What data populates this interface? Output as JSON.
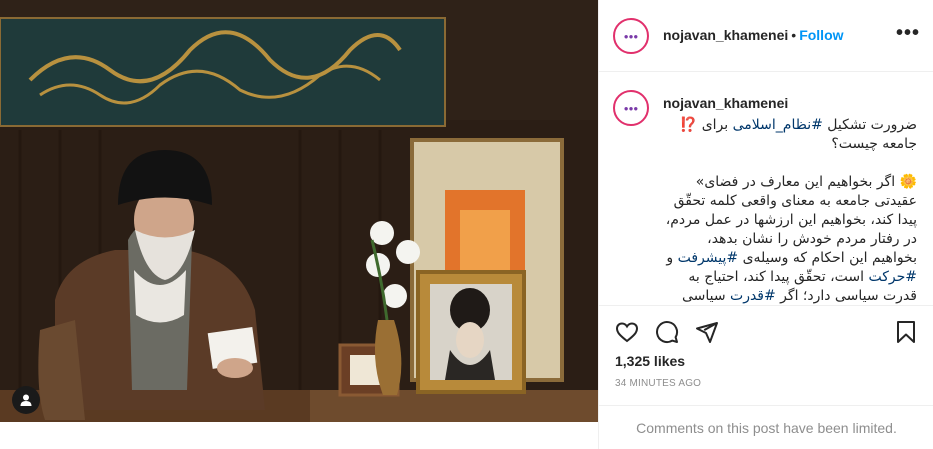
{
  "post": {
    "username": "nojavan_khamenei",
    "follow_label": "Follow",
    "separator": "•",
    "more_label": "•••",
    "caption_username": "nojavan_khamenei",
    "caption_line1_a": "ضرورت تشکیل ",
    "caption_hashtag1": "#نظام_اسلامی",
    "caption_line1_b": " برای ⁉️ جامعه چیست؟",
    "caption_para2_a": "🌼 اگر بخواهیم این معارف در فضای» عقیدتی جامعه به معنای واقعی کلمه تحقّق پیدا کند، بخواهیم این ارزشها در عمل مردم، در رفتار مردم خودش را نشان بدهد، بخواهیم این احکام که وسیله‌ی ",
    "caption_hashtag2": "#پیشرفت",
    "caption_para2_b": " و ",
    "caption_hashtag3": "#حرکت",
    "caption_para2_c": " است، تحقّق پیدا کند، احتیاج به قدرت سیاسی دارد؛ اگر ",
    "caption_hashtag4": "#قدرت",
    "caption_para2_d": " سیاسی نباشد، قادر نخواهد بود نقش خود را ایفا کند",
    "likes": "1,325 likes",
    "time": "34 MINUTES AGO",
    "comments_notice": "Comments on this post have been limited."
  },
  "icons": {
    "heart": "heart-icon",
    "comment": "comment-icon",
    "share": "share-icon",
    "save": "bookmark-icon",
    "user_tag": "user-icon"
  },
  "colors": {
    "follow": "#0095f6",
    "hashtag": "#00376b",
    "muted": "#8e8e8e"
  }
}
